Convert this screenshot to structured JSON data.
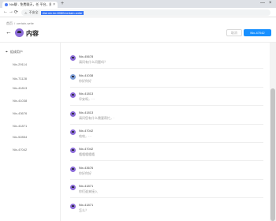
{
  "browser": {
    "tab_title": "Nix聊 - 免费聊天，任 平台，随入 ...",
    "tab_close": "×",
    "new_tab": "+",
    "window_controls": {
      "minimize": "—",
      "close": "×"
    },
    "nav": {
      "back": "←",
      "forward": "→",
      "reload": "⟳"
    },
    "security_label": "不安全",
    "url": "dial.nix.im:8080/certain-write"
  },
  "breadcrumb": {
    "parent": "首页",
    "separator": "/",
    "current": "certain-write"
  },
  "page": {
    "back": "←",
    "title": "内容",
    "cancel_label": "取消",
    "primary_label": "Nix-47042"
  },
  "left_panel": {
    "header_icon": "pin-icon",
    "header": "组成用户",
    "items": [
      "Nix-29114",
      "Nix-71128",
      "Nix-41813",
      "Nix-41038",
      "Nix-43676",
      "Nix-41871",
      "Nix-52854",
      "Nix-47042"
    ]
  },
  "messages": [
    {
      "name": "Nix-45678",
      "text": "请问有什么问题吗？"
    },
    {
      "name": "Nix-41038",
      "text": "你好你好"
    },
    {
      "name": "Nix-41813",
      "text": "早安呀，···"
    },
    {
      "name": "Nix-41813",
      "text": "请问您有什么需要帮忙，·"
    },
    {
      "name": "Nix-47042",
      "text": "哈哈，···"
    },
    {
      "name": "Nix-47042",
      "text": "嘻嘻嘻嘻嘻"
    },
    {
      "name": "Nix-43676",
      "text": "你好你好"
    },
    {
      "name": "Nix-41871",
      "text": "你们谁来接入"
    },
    {
      "name": "Nix-41871",
      "text": "怎么？"
    }
  ],
  "colors": {
    "primary": "#1890ff",
    "avatar_purple": "#8c6cd8",
    "url_highlight": "#3876f5"
  }
}
